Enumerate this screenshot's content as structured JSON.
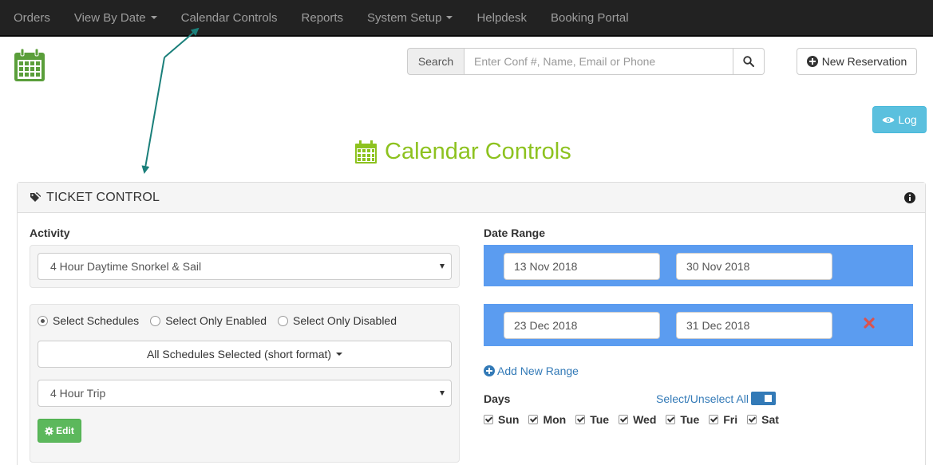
{
  "navbar": {
    "items": [
      {
        "label": "Orders",
        "dropdown": false
      },
      {
        "label": "View By Date",
        "dropdown": true
      },
      {
        "label": "Calendar Controls",
        "dropdown": false
      },
      {
        "label": "Reports",
        "dropdown": false
      },
      {
        "label": "System Setup",
        "dropdown": true
      },
      {
        "label": "Helpdesk",
        "dropdown": false
      },
      {
        "label": "Booking Portal",
        "dropdown": false
      }
    ]
  },
  "search": {
    "addon_label": "Search",
    "placeholder": "Enter Conf #, Name, Email or Phone",
    "value": ""
  },
  "header_actions": {
    "new_reservation_label": "New Reservation",
    "log_label": "Log"
  },
  "page": {
    "title": "Calendar Controls"
  },
  "panel": {
    "title": "TICKET CONTROL",
    "activity": {
      "label": "Activity",
      "selected": "4 Hour Daytime Snorkel & Sail"
    },
    "schedules": {
      "radios": [
        {
          "label": "Select Schedules",
          "checked": true
        },
        {
          "label": "Select Only Enabled",
          "checked": false
        },
        {
          "label": "Select Only Disabled",
          "checked": false
        }
      ],
      "dropdown_label": "All Schedules Selected (short format)",
      "trip_selected": "4 Hour Trip",
      "edit_label": "Edit"
    },
    "date_range": {
      "label": "Date Range",
      "ranges": [
        {
          "start": "13 Nov 2018",
          "end": "30 Nov 2018",
          "removable": false
        },
        {
          "start": "23 Dec 2018",
          "end": "31 Dec 2018",
          "removable": true
        }
      ],
      "add_label": "Add New Range"
    },
    "days": {
      "label": "Days",
      "select_all_label": "Select/Unselect All",
      "select_all_on": true,
      "items": [
        {
          "label": "Sun",
          "checked": true
        },
        {
          "label": "Mon",
          "checked": true
        },
        {
          "label": "Tue",
          "checked": true
        },
        {
          "label": "Wed",
          "checked": true
        },
        {
          "label": "Tue",
          "checked": true
        },
        {
          "label": "Fri",
          "checked": true
        },
        {
          "label": "Sat",
          "checked": true
        }
      ]
    }
  },
  "colors": {
    "navbar_bg": "#222222",
    "brand_green": "#8dc21f",
    "logo_green": "#5a9e3a",
    "range_blue": "#5b9cf0",
    "link_blue": "#337ab7",
    "info_btn": "#5bc0de",
    "success_btn": "#5cb85c",
    "remove_red": "#d9534f",
    "annotation_arrow": "#1a7f7a"
  }
}
